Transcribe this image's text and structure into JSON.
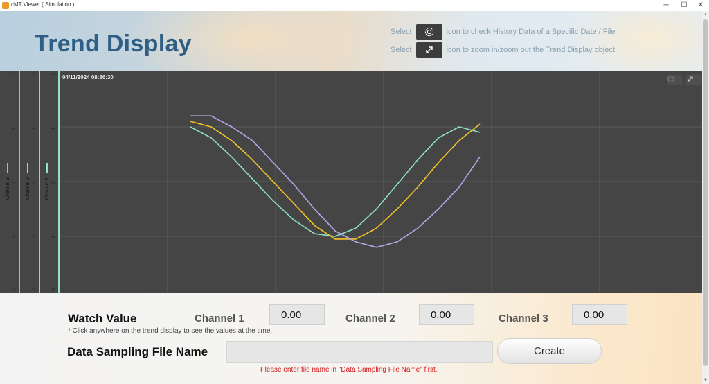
{
  "window": {
    "title": "cMT Viewer ( Simulation )",
    "controls": {
      "minimize": "─",
      "maximize": "☐",
      "close": "✕"
    }
  },
  "header": {
    "title": "Trend Display",
    "help": [
      {
        "prefix": "Select",
        "icon": "gear-icon",
        "text": "icon to check History Data of a Specific Date / File"
      },
      {
        "prefix": "Select",
        "icon": "expand-icon",
        "text": "icon to zoom in/zoom out the Trend Display object"
      }
    ]
  },
  "trend": {
    "timestamp": "04/11/2024 08:36:30",
    "background": "#454545",
    "grid_color": "#5a5a5a",
    "y_range": [
      -2,
      2
    ],
    "y_ticks": [
      "-2",
      "-1",
      "0",
      "1",
      "2"
    ],
    "channels": [
      {
        "name": "Channel 1",
        "color": "#8fe3c4"
      },
      {
        "name": "Channel 2",
        "color": "#f6c629"
      },
      {
        "name": "Channel 3",
        "color": "#b9a6e8"
      }
    ]
  },
  "chart_data": {
    "type": "line",
    "ylim": [
      -2,
      2
    ],
    "grid": true,
    "series": [
      {
        "name": "Channel 1",
        "values": [
          1.0,
          0.8,
          0.45,
          0.05,
          -0.35,
          -0.7,
          -0.95,
          -1.0,
          -0.85,
          -0.5,
          -0.05,
          0.4,
          0.8,
          1.0,
          0.9
        ]
      },
      {
        "name": "Channel 2",
        "values": [
          1.1,
          1.0,
          0.75,
          0.4,
          0.0,
          -0.4,
          -0.8,
          -1.05,
          -1.05,
          -0.85,
          -0.5,
          -0.1,
          0.35,
          0.75,
          1.05
        ]
      },
      {
        "name": "Channel 3",
        "values": [
          1.2,
          1.2,
          1.0,
          0.75,
          0.35,
          -0.05,
          -0.5,
          -0.9,
          -1.1,
          -1.2,
          -1.1,
          -0.85,
          -0.5,
          -0.1,
          0.45
        ]
      }
    ]
  },
  "watch": {
    "title": "Watch Value",
    "hint": "* Click anywhere on the trend display to see the values at the time.",
    "channels": [
      {
        "label": "Channel 1",
        "value": "0.00"
      },
      {
        "label": "Channel 2",
        "value": "0.00"
      },
      {
        "label": "Channel 3",
        "value": "0.00"
      }
    ]
  },
  "file": {
    "label": "Data Sampling File Name",
    "value": "",
    "create_label": "Create",
    "warning": "Please enter file name in \"Data Sampling File Name\" first."
  }
}
